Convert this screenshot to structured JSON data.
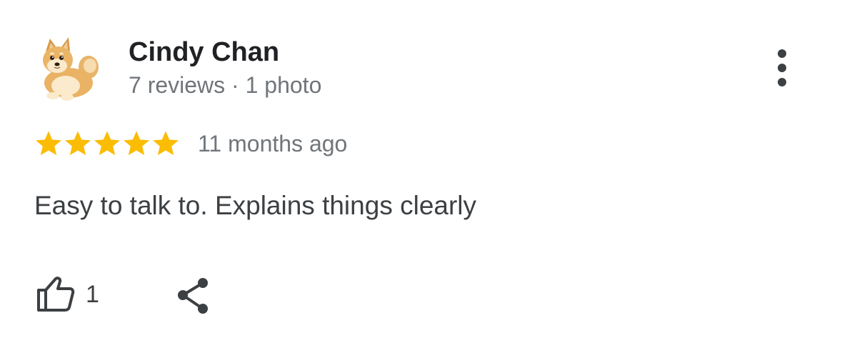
{
  "review": {
    "author_name": "Cindy Chan",
    "author_meta": "7 reviews · 1 photo",
    "rating": 5,
    "rating_max": 5,
    "time": "11 months ago",
    "text": "Easy to talk to. Explains things clearly",
    "like_count": "1"
  },
  "icons": {
    "avatar": "shiba-dog-avatar",
    "more": "more-vert-icon",
    "star": "star-icon",
    "like": "thumb-up-icon",
    "share": "share-icon"
  },
  "colors": {
    "star": "#fbbc04",
    "name": "#202124",
    "meta": "#70757a",
    "text": "#3c4043",
    "icon": "#3c4043"
  }
}
